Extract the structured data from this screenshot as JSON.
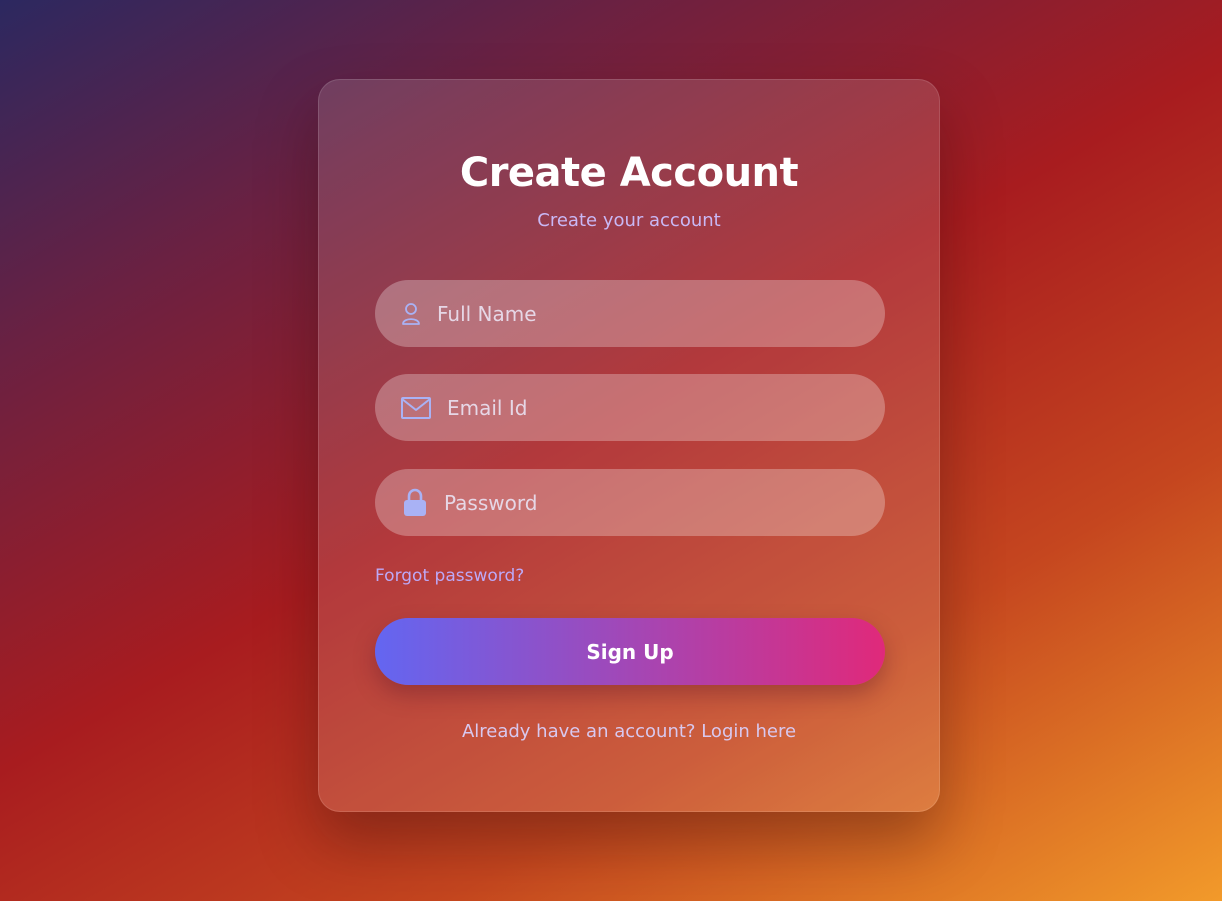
{
  "form": {
    "title": "Create Account",
    "subtitle": "Create your account",
    "fields": [
      {
        "id": "full_name",
        "placeholder": "Full Name",
        "value": "",
        "icon": "user-icon"
      },
      {
        "id": "email",
        "placeholder": "Email Id",
        "value": "",
        "icon": "mail-icon"
      },
      {
        "id": "password",
        "placeholder": "Password",
        "value": "",
        "icon": "lock-icon"
      }
    ],
    "forgot_label": "Forgot password?",
    "submit_label": "Sign Up",
    "already_text": "Already have an account?",
    "login_label": "Login here"
  },
  "colors": {
    "icon": "#a9b2f5",
    "accent_start": "#6366f1",
    "accent_end": "#e0297a",
    "link": "#bda9f7"
  }
}
